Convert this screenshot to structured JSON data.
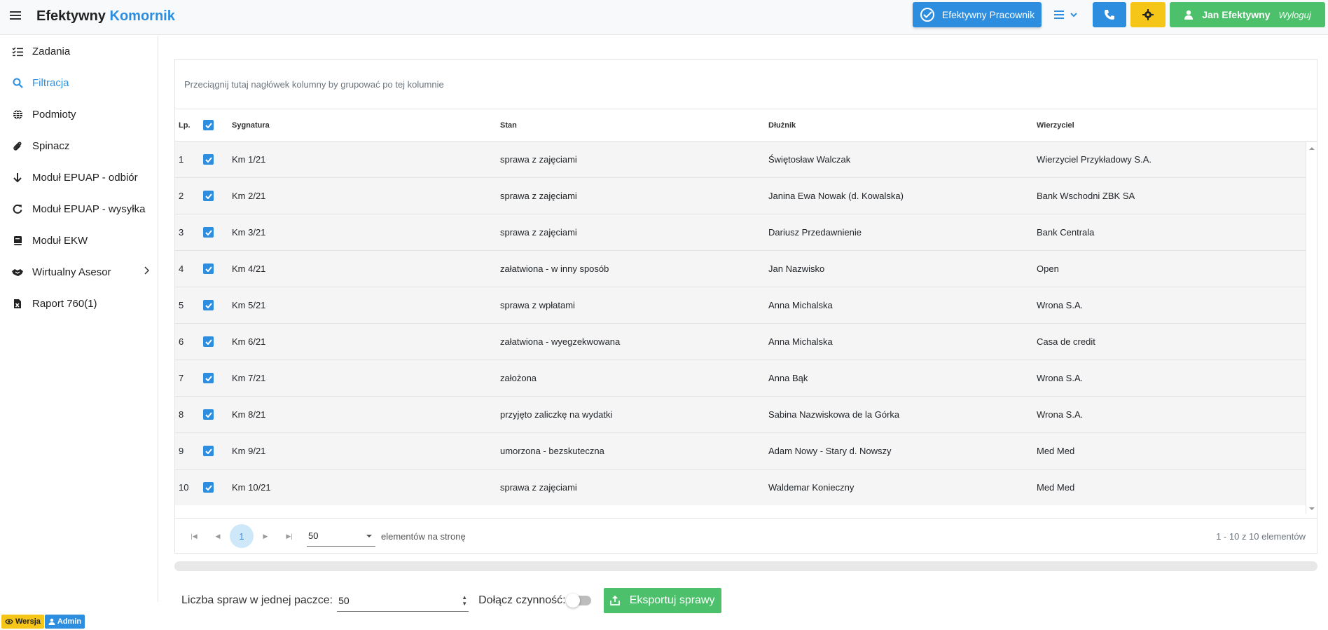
{
  "header": {
    "brand_main": "Efektywny",
    "brand_accent": "Komornik",
    "pracownik_label": "Efektywny Pracownik",
    "user_name": "Jan Efektywny",
    "logout_label": "Wyloguj"
  },
  "sidebar": {
    "items": [
      {
        "label": "Zadania",
        "icon": "tasks-list-icon"
      },
      {
        "label": "Filtracja",
        "icon": "search-icon"
      },
      {
        "label": "Podmioty",
        "icon": "globe-icon"
      },
      {
        "label": "Spinacz",
        "icon": "paperclip-icon"
      },
      {
        "label": "Moduł EPUAP - odbiór",
        "icon": "arrow-down-icon"
      },
      {
        "label": "Moduł EPUAP - wysyłka",
        "icon": "refresh-icon"
      },
      {
        "label": "Moduł EKW",
        "icon": "book-icon"
      },
      {
        "label": "Wirtualny Asesor",
        "icon": "handshake-icon"
      },
      {
        "label": "Raport 760(1)",
        "icon": "excel-file-icon"
      }
    ]
  },
  "grid": {
    "group_panel": "Przeciągnij tutaj nagłówek kolumny by grupować po tej kolumnie",
    "columns": {
      "lp": "Lp.",
      "sygnatura": "Sygnatura",
      "stan": "Stan",
      "dluznik": "Dłużnik",
      "wierzyciel": "Wierzyciel"
    },
    "rows": [
      {
        "lp": "1",
        "sygnatura": "Km 1/21",
        "stan": "sprawa z zajęciami",
        "dluznik": "Świętosław Walczak",
        "wierzyciel": "Wierzyciel Przykładowy S.A."
      },
      {
        "lp": "2",
        "sygnatura": "Km 2/21",
        "stan": "sprawa z zajęciami",
        "dluznik": "Janina Ewa Nowak (d. Kowalska)",
        "wierzyciel": "Bank Wschodni ZBK SA"
      },
      {
        "lp": "3",
        "sygnatura": "Km 3/21",
        "stan": "sprawa z zajęciami",
        "dluznik": "Dariusz Przedawnienie",
        "wierzyciel": "Bank Centrala"
      },
      {
        "lp": "4",
        "sygnatura": "Km 4/21",
        "stan": "załatwiona - w inny sposób",
        "dluznik": "Jan Nazwisko",
        "wierzyciel": "Open"
      },
      {
        "lp": "5",
        "sygnatura": "Km 5/21",
        "stan": "sprawa z wpłatami",
        "dluznik": "Anna Michalska",
        "wierzyciel": "Wrona S.A."
      },
      {
        "lp": "6",
        "sygnatura": "Km 6/21",
        "stan": "załatwiona - wyegzekwowana",
        "dluznik": "Anna Michalska",
        "wierzyciel": "Casa de credit"
      },
      {
        "lp": "7",
        "sygnatura": "Km 7/21",
        "stan": "założona",
        "dluznik": "Anna Bąk",
        "wierzyciel": "Wrona S.A."
      },
      {
        "lp": "8",
        "sygnatura": "Km 8/21",
        "stan": "przyjęto zaliczkę na wydatki",
        "dluznik": "Sabina Nazwiskowa de la Górka",
        "wierzyciel": "Wrona S.A."
      },
      {
        "lp": "9",
        "sygnatura": "Km 9/21",
        "stan": "umorzona - bezskuteczna",
        "dluznik": "Adam Nowy - Stary d. Nowszy",
        "wierzyciel": "Med Med"
      },
      {
        "lp": "10",
        "sygnatura": "Km 10/21",
        "stan": "sprawa z zajęciami",
        "dluznik": "Waldemar Konieczny",
        "wierzyciel": "Med Med"
      }
    ],
    "pager": {
      "current_page": "1",
      "page_size": "50",
      "per_page_label": "elementów na stronę",
      "info": "1 - 10 z 10 elementów"
    }
  },
  "export": {
    "batch_label": "Liczba spraw w jednej paczce:",
    "batch_value": "50",
    "attach_label": "Dołącz czynność:",
    "attach_checked": false,
    "export_button": "Eksportuj sprawy"
  },
  "badges": {
    "wersja": "Wersja",
    "admin": "Admin"
  },
  "colors": {
    "primary": "#2d8ee0",
    "success": "#4cc06a",
    "warning": "#f5c518"
  }
}
